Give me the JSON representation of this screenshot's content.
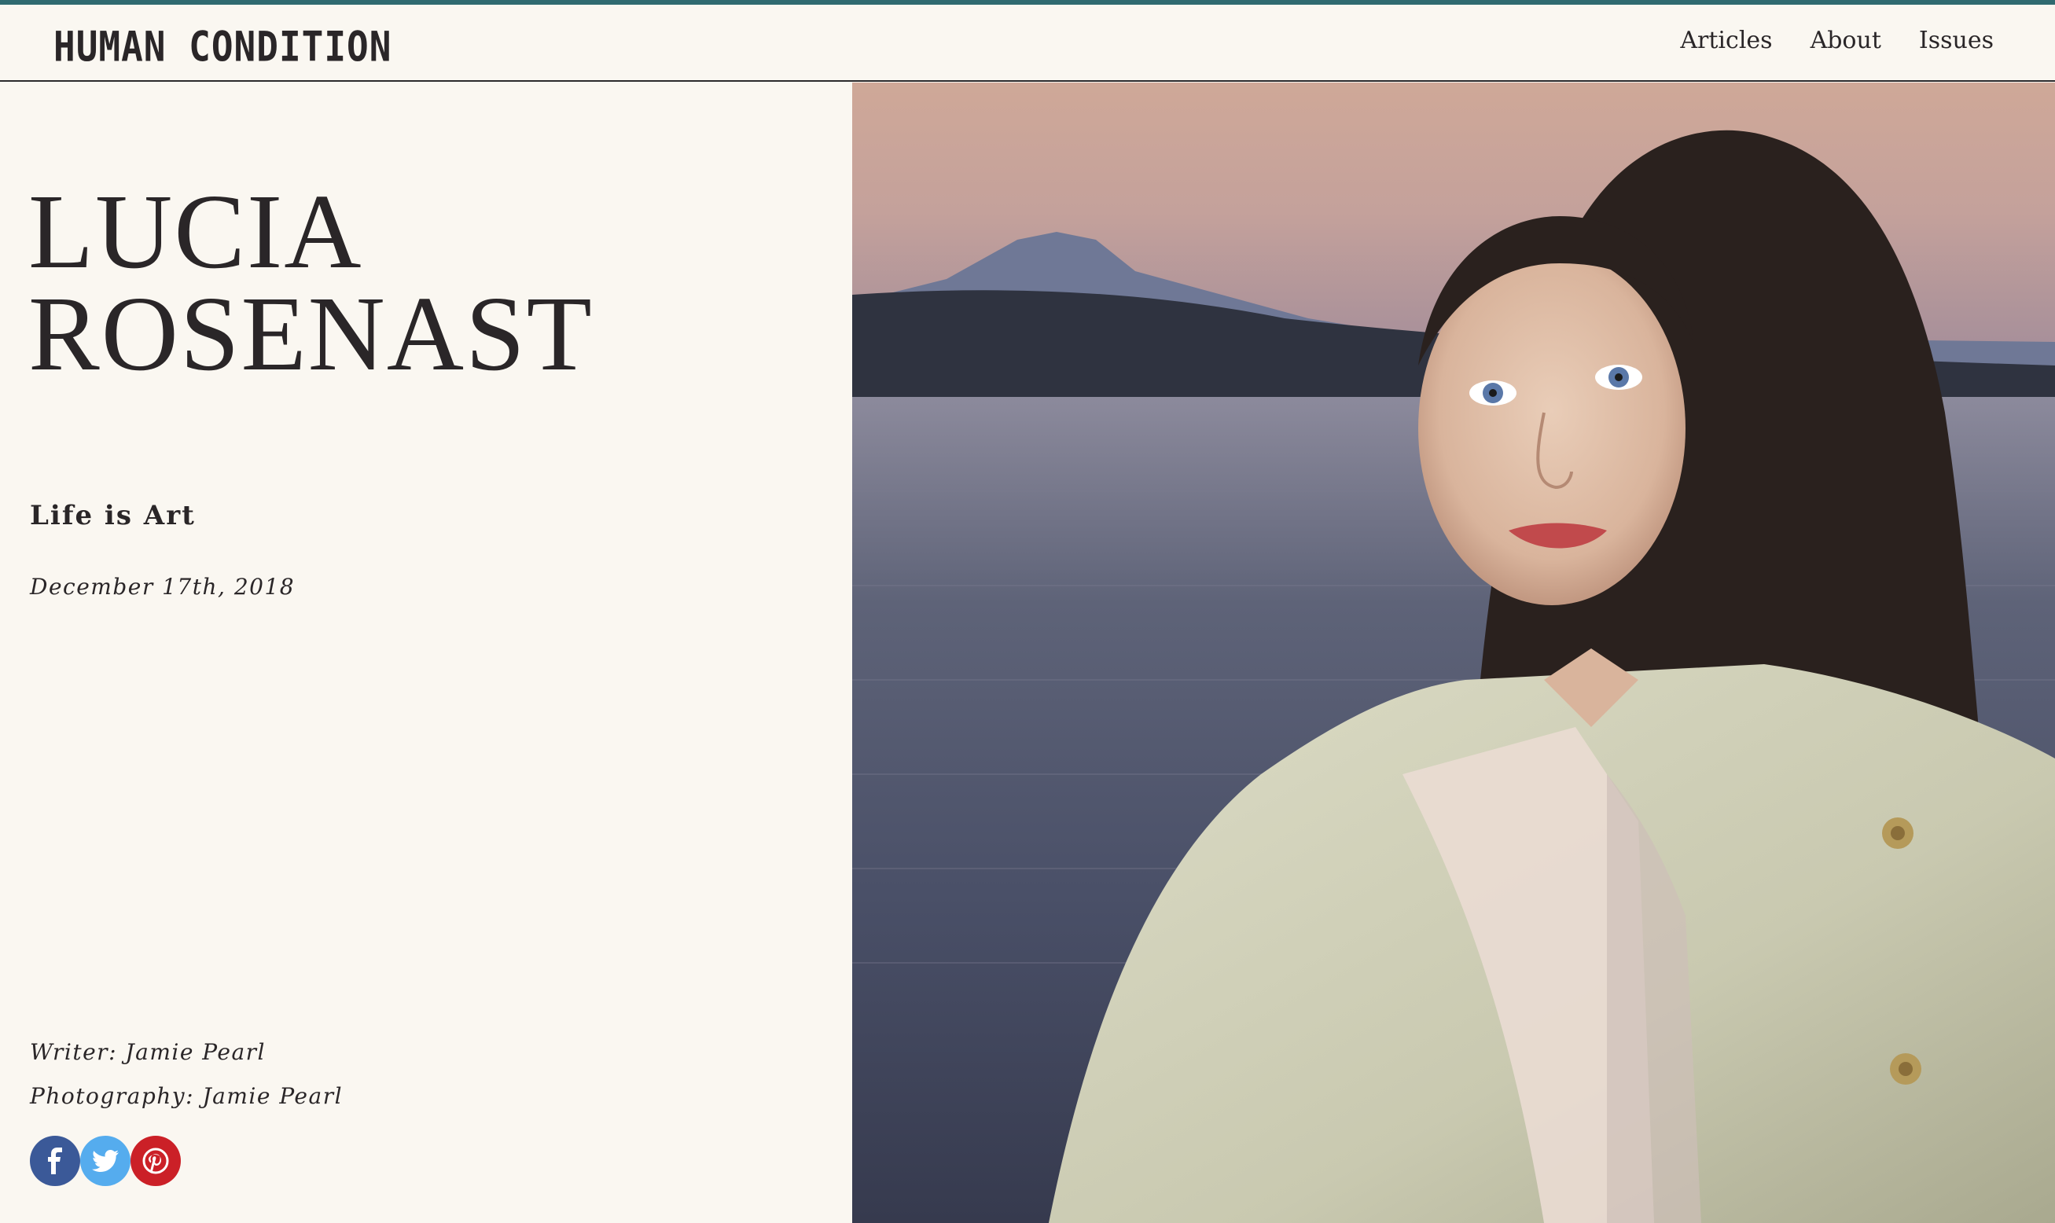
{
  "header": {
    "logo": "HUMAN CONDITION",
    "nav": [
      "Articles",
      "About",
      "Issues"
    ]
  },
  "article": {
    "title_line1": "LUCIA",
    "title_line2": "ROSENAST",
    "subtitle": "Life is Art",
    "date": "December 17th, 2018",
    "writer": "Writer: Jamie Pearl",
    "photography": "Photography: Jamie Pearl"
  },
  "share": {
    "icons": [
      "facebook-icon",
      "twitter-icon",
      "pinterest-icon"
    ],
    "colors": {
      "facebook": "#3b5998",
      "twitter": "#55acee",
      "pinterest": "#cb2027"
    }
  },
  "colors": {
    "accent_stripe": "#2f6a70",
    "background": "#faf7f1",
    "text": "#2a2628"
  }
}
